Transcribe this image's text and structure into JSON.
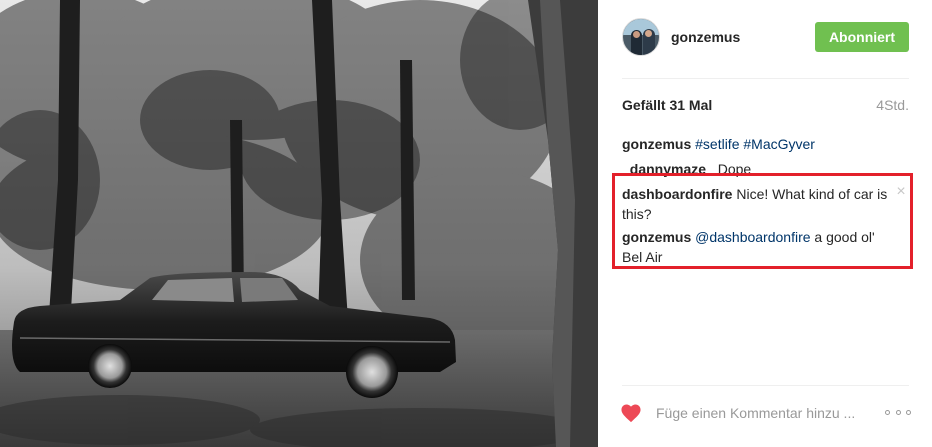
{
  "header": {
    "username": "gonzemus",
    "follow_label": "Abonniert"
  },
  "meta": {
    "likes": "Gefällt 31 Mal",
    "time": "4Std."
  },
  "comments": [
    {
      "user": "gonzemus",
      "hashtags": [
        "#setlife",
        "#MacGyver"
      ]
    },
    {
      "user": "_dannymaze_",
      "text": "Dope"
    },
    {
      "user": "dashboardonfire",
      "text": "Nice! What kind of car is this?"
    },
    {
      "user": "gonzemus",
      "mention": "@dashboardonfire",
      "text": "a good ol' Bel Air"
    }
  ],
  "footer": {
    "comment_placeholder": "Füge einen Kommentar hinzu ..."
  },
  "colors": {
    "follow_button": "#70c050",
    "hashtag_link": "#003569",
    "highlight_box": "#e3202a",
    "like_heart": "#ed4956"
  },
  "icons": {
    "like": "heart-icon",
    "more": "more-options-icon",
    "delete": "close-icon"
  }
}
